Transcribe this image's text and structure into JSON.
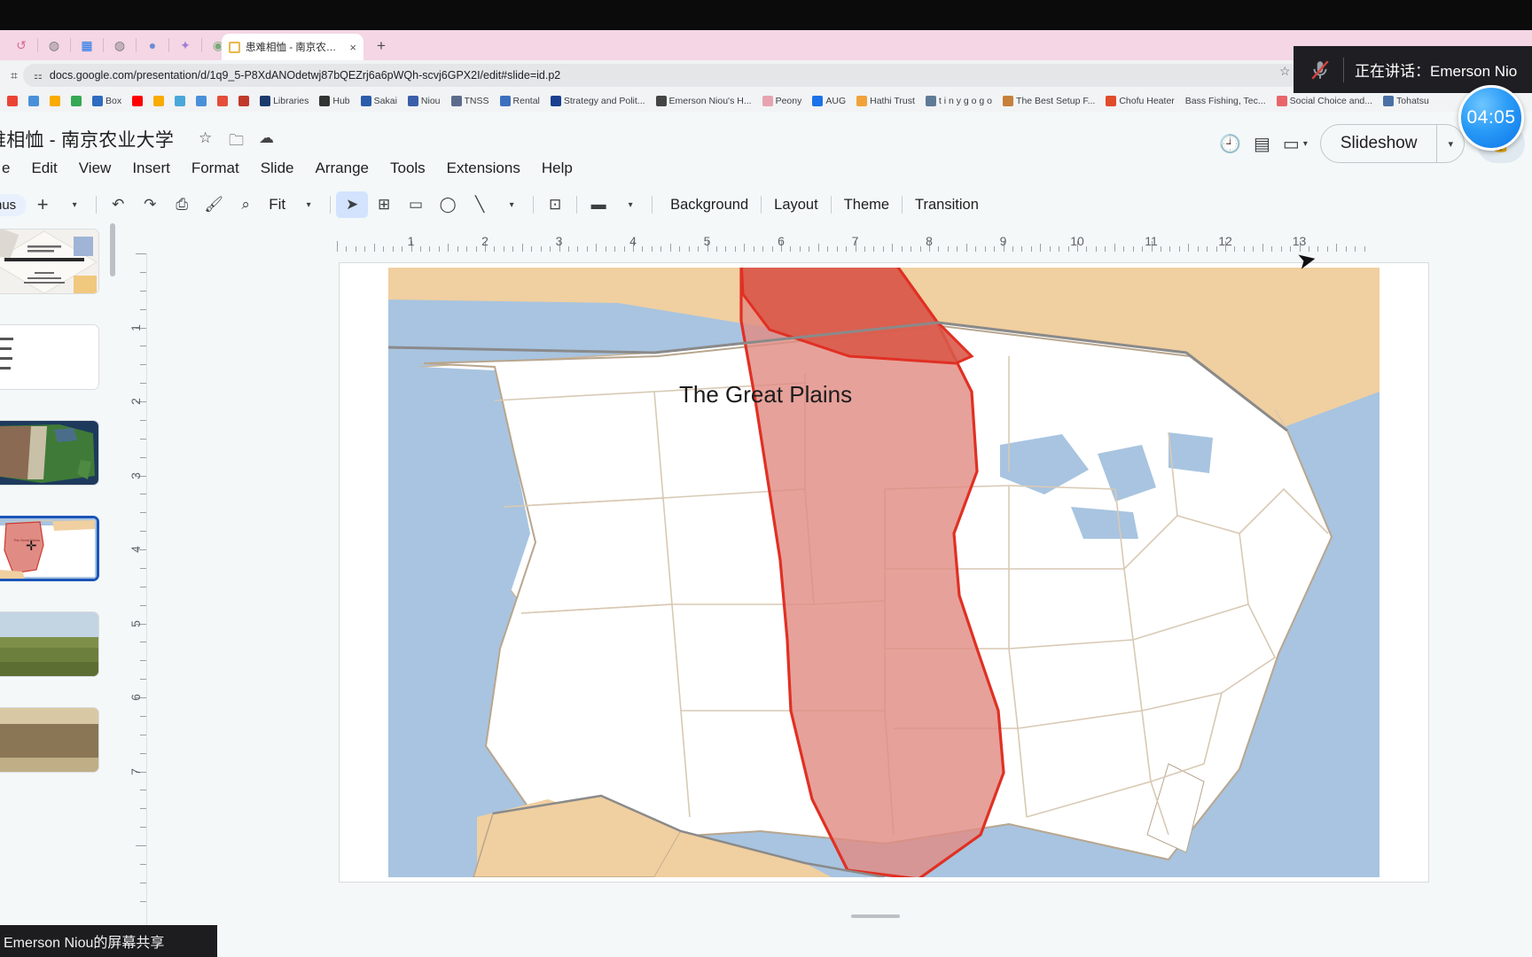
{
  "browser": {
    "tab": {
      "title": "患难相恤 - 南京农业大学 - Goo",
      "favicon": "slides-icon",
      "close": "×"
    },
    "newtab_label": "+",
    "toolbar_icons": [
      "back-icon",
      "forward-icon",
      "sheets-icon",
      "globe-icon",
      "chat-bubble-icon",
      "sparkle-icon",
      "app-icon"
    ],
    "omnibox": {
      "url": "docs.google.com/presentation/d/1q9_5-P8XdANOdetwj87bQEZrj6a6pWQh-scvj6GPX2I/edit#slide=id.p2",
      "tune_icon": "tune-icon",
      "star_icon": "star-icon"
    },
    "bookmarks": [
      {
        "label": "",
        "icon": "gmail-icon",
        "color": "#ea4335"
      },
      {
        "label": "",
        "icon": "person-icon",
        "color": "#4a90d9"
      },
      {
        "label": "",
        "icon": "maps-icon",
        "color": "#f9ab00"
      },
      {
        "label": "",
        "icon": "drive-icon",
        "color": "#34a853"
      },
      {
        "label": "Box",
        "icon": "box-icon",
        "color": "#2f6bbf"
      },
      {
        "label": "",
        "icon": "youtube-icon",
        "color": "#ff0000"
      },
      {
        "label": "",
        "icon": "run-icon",
        "color": "#f9ab00"
      },
      {
        "label": "",
        "icon": "circle-icon",
        "color": "#4aa7d9"
      },
      {
        "label": "",
        "icon": "diamond-icon",
        "color": "#4a90d9"
      },
      {
        "label": "",
        "icon": "news-icon",
        "color": "#e44d3a"
      },
      {
        "label": "",
        "icon": "wp-icon",
        "color": "#c0392b"
      },
      {
        "label": "Libraries",
        "icon": "library-icon",
        "color": "#1b3a6b"
      },
      {
        "label": "Hub",
        "icon": "hub-icon",
        "color": "#333333"
      },
      {
        "label": "Sakai",
        "icon": "sakai-icon",
        "color": "#2a5caa"
      },
      {
        "label": "Niou",
        "icon": "niou-icon",
        "color": "#3a5fa8"
      },
      {
        "label": "TNSS",
        "icon": "tnss-icon",
        "color": "#5c6b8a"
      },
      {
        "label": "Rental",
        "icon": "rental-icon",
        "color": "#3d6fbf"
      },
      {
        "label": "Strategy and Polit...",
        "icon": "strategy-icon",
        "color": "#1a3f8f"
      },
      {
        "label": "Emerson Niou's H...",
        "icon": "home-icon",
        "color": "#444444"
      },
      {
        "label": "Peony",
        "icon": "peony-icon",
        "color": "#e7a4b0"
      },
      {
        "label": "AUG",
        "icon": "aug-icon",
        "color": "#1a73e8"
      },
      {
        "label": "Hathi Trust",
        "icon": "hathi-icon",
        "color": "#f0a33a"
      },
      {
        "label": "t i n y g o g o",
        "icon": "tinygogo-icon",
        "color": "#5f7a96"
      },
      {
        "label": "The Best Setup F...",
        "icon": "setup-icon",
        "color": "#c77f3a"
      },
      {
        "label": "Chofu Heater",
        "icon": "chofu-icon",
        "color": "#e04b2a"
      },
      {
        "label": "Bass Fishing, Tec...",
        "icon": "",
        "color": "transparent"
      },
      {
        "label": "Social Choice and...",
        "icon": "social-icon",
        "color": "#e8656a"
      },
      {
        "label": "Tohatsu",
        "icon": "tohatsu-icon",
        "color": "#4a6fa5"
      }
    ]
  },
  "slides": {
    "doc_title": "难相恤 - 南京农业大学",
    "title_icons": [
      "star-icon",
      "move-to-folder-icon",
      "cloud-saved-icon"
    ],
    "menus": [
      "e",
      "Edit",
      "View",
      "Insert",
      "Format",
      "Slide",
      "Arrange",
      "Tools",
      "Extensions",
      "Help"
    ],
    "toolbar": {
      "menus_chip": "nus",
      "plus_label": "+",
      "zoom_value": "Fit",
      "icons": [
        "undo-icon",
        "redo-icon",
        "print-icon",
        "paint-format-icon",
        "zoom-icon",
        "select-icon",
        "textbox-icon",
        "image-icon",
        "shape-icon",
        "line-icon",
        "new-slide-icon",
        "transition-icon"
      ],
      "words": [
        "Background",
        "Layout",
        "Theme",
        "Transition"
      ]
    },
    "header_right": {
      "icons": [
        "version-history-icon",
        "comment-icon",
        "meet-icon"
      ],
      "slideshow_label": "Slideshow",
      "slideshow_caret": "▾",
      "lock_icon": "lock-icon"
    },
    "ruler": {
      "h_ticks": [
        "1",
        "2",
        "3",
        "4",
        "5",
        "6",
        "7",
        "8",
        "9",
        "10",
        "11",
        "12",
        "13"
      ],
      "v_ticks": [
        "1",
        "2",
        "3",
        "4",
        "5",
        "6",
        "7"
      ]
    },
    "filmstrip": [
      {
        "index": "1",
        "type": "title-slide",
        "active": false
      },
      {
        "index": "2",
        "type": "text-slide",
        "active": false
      },
      {
        "index": "3",
        "type": "relief-map-slide",
        "active": false
      },
      {
        "index": "4",
        "type": "great-plains-map-slide",
        "active": true
      },
      {
        "index": "5",
        "type": "grassland-photo-slide",
        "active": false
      },
      {
        "index": "6",
        "type": "bison-photo-slide",
        "active": false
      }
    ],
    "canvas": {
      "slide_label": "The Great Plains",
      "cursor": "cursor-icon"
    }
  },
  "overlay": {
    "mic_icon": "mic-muted-icon",
    "speaking_text": "正在讲话：Emerson Nio",
    "timer": "04:05"
  },
  "share_bar": {
    "text": "Emerson Niou的屏幕共享"
  },
  "colors": {
    "tabstrip_pink": "#f4d6e4",
    "accent_blue": "#1b54b8",
    "plains_red": "#e05a4e",
    "plains_fill": "#e08c84",
    "ocean_blue": "#a8c4e0",
    "land_tan": "#f0cfa0",
    "timer_blue": "#2a9bf7"
  }
}
